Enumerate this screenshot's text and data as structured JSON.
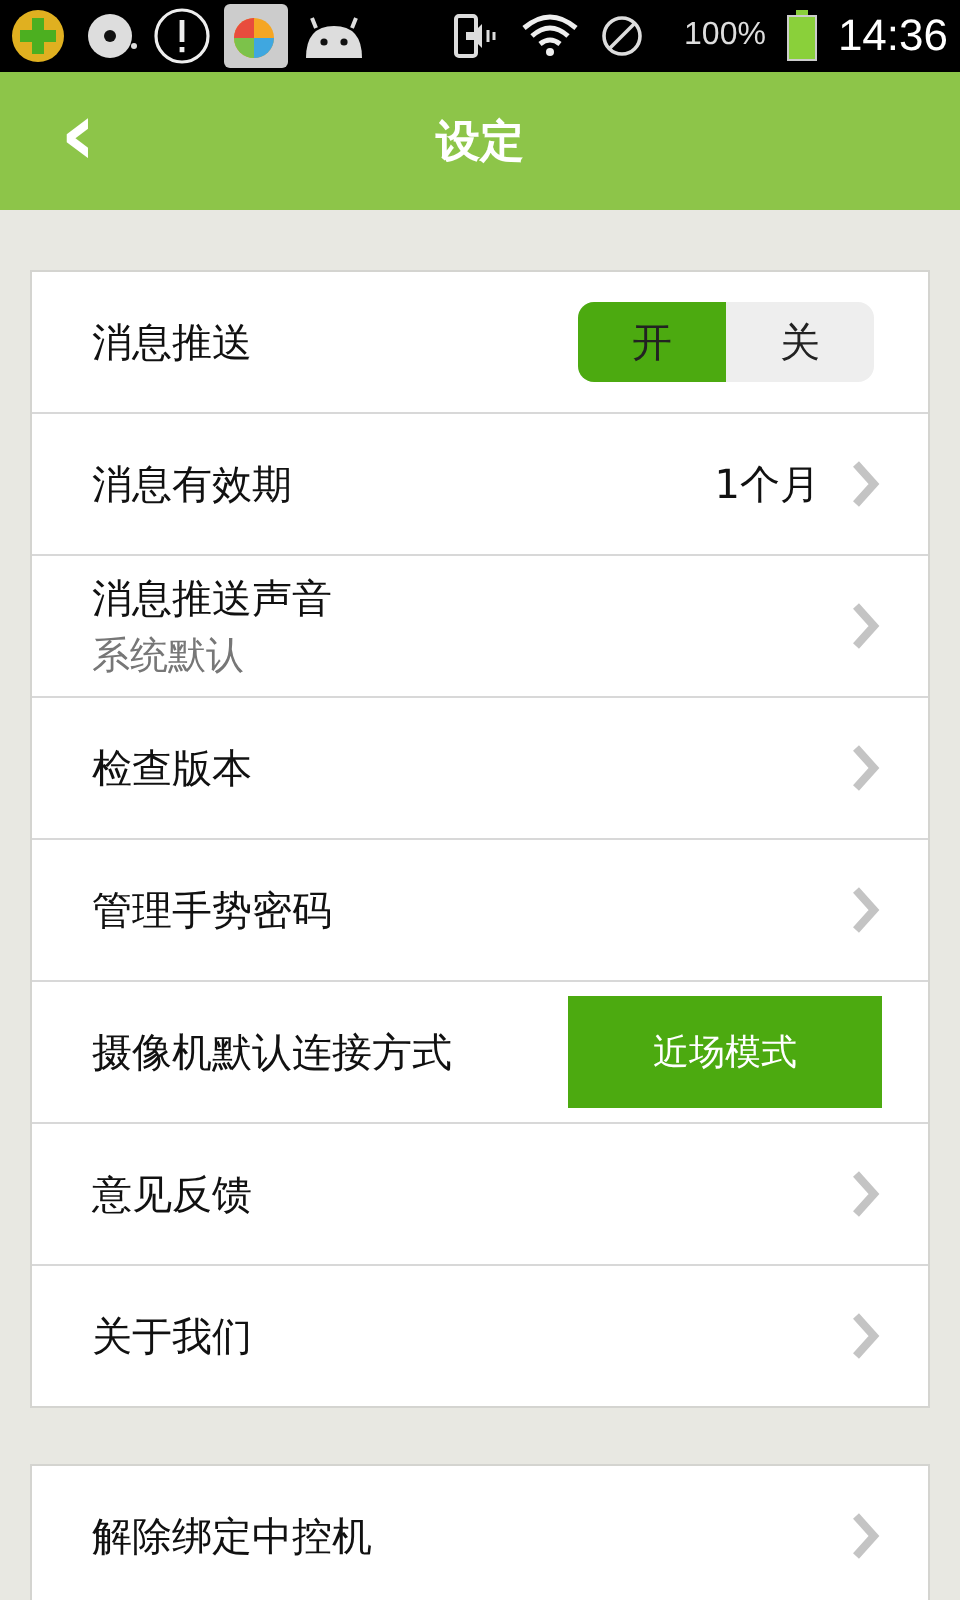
{
  "status_bar": {
    "battery_percent": "100%",
    "time": "14:36"
  },
  "header": {
    "back": "‹",
    "title": "设定"
  },
  "groups": [
    {
      "rows": [
        {
          "kind": "toggle",
          "label": "消息推送",
          "options": [
            {
              "label": "开",
              "selected": true
            },
            {
              "label": "关",
              "selected": false
            }
          ]
        },
        {
          "kind": "value",
          "label": "消息有效期",
          "value": "1个月"
        },
        {
          "kind": "subtitle",
          "label": "消息推送声音",
          "subtitle": "系统默认"
        },
        {
          "kind": "link",
          "label": "检查版本"
        },
        {
          "kind": "link",
          "label": "管理手势密码"
        },
        {
          "kind": "button",
          "label": "摄像机默认连接方式",
          "button": "近场模式"
        },
        {
          "kind": "link",
          "label": "意见反馈"
        },
        {
          "kind": "link",
          "label": "关于我们"
        }
      ]
    },
    {
      "rows": [
        {
          "kind": "link",
          "label": "解除绑定中控机"
        }
      ]
    }
  ]
}
